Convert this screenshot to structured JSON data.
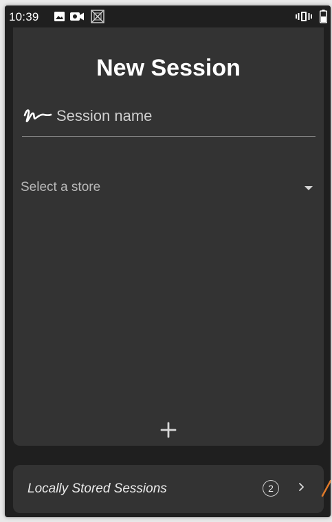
{
  "status_bar": {
    "time": "10:39",
    "icons": [
      "image-icon",
      "video-icon",
      "no-sim-icon",
      "vibrate-icon",
      "battery-icon"
    ]
  },
  "new_session": {
    "title": "New Session",
    "name_field": {
      "placeholder": "Session name",
      "value": "",
      "icon": "signature-icon"
    },
    "store_select": {
      "selected": "Select a store",
      "icon": "dropdown-arrow-icon"
    },
    "add_icon": "plus-icon"
  },
  "local_sessions": {
    "label": "Locally Stored Sessions",
    "count": "2",
    "icon": "chevron-right-icon"
  },
  "colors": {
    "background": "#1f1f1f",
    "card": "#333333",
    "text": "#ffffff",
    "muted_text": "#b9b9b9",
    "annotation": "#e07a2a"
  }
}
